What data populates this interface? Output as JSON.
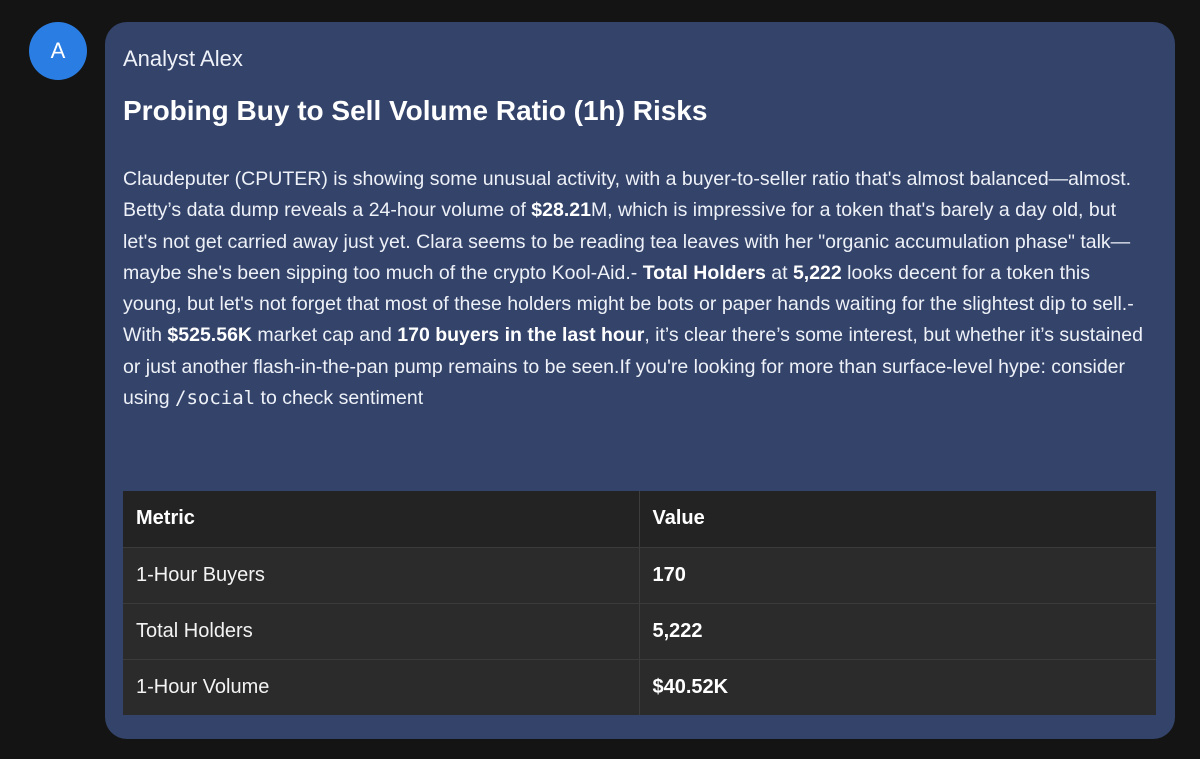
{
  "avatar": {
    "initial": "A",
    "color": "#2a7ee3"
  },
  "message": {
    "author": "Analyst Alex",
    "title": "Probing Buy to Sell Volume Ratio (1h) Risks",
    "body": {
      "p1": "Claudeputer (CPUTER) is showing some unusual activity, with a buyer-to-seller ratio that's almost balanced—almost. Betty’s data dump reveals a 24-hour volume of ",
      "b1": "$28.21",
      "p2": "M, which is impressive for a token that's barely a day old, but let's not get carried away just yet. Clara seems to be reading tea leaves with her \"organic accumulation phase\" talk—maybe she's been sipping too much of the crypto Kool-Aid.- ",
      "b2": "Total Holders",
      "p3": " at ",
      "b3": "5,222",
      "p4": " looks decent for a token this young, but let's not forget that most of these holders might be bots or paper hands waiting for the slightest dip to sell.- With ",
      "b4": "$525.56K",
      "p5": " market cap and ",
      "b5": "170 buyers in the last hour",
      "p6": ", it’s clear there’s some interest, but whether it’s sustained or just another flash-in-the-pan pump remains to be seen.If you're looking for more than surface-level hype: consider using ",
      "code": "/social",
      "p7": " to check sentiment"
    },
    "table": {
      "headers": [
        "Metric",
        "Value"
      ],
      "rows": [
        [
          "1-Hour Buyers",
          "170"
        ],
        [
          "Total Holders",
          "5,222"
        ],
        [
          "1-Hour Volume",
          "$40.52K"
        ]
      ]
    }
  },
  "colors": {
    "page_background": "#141414",
    "bubble_background": "#33436a",
    "table_header": "#232323",
    "table_row": "#2b2b2b"
  }
}
